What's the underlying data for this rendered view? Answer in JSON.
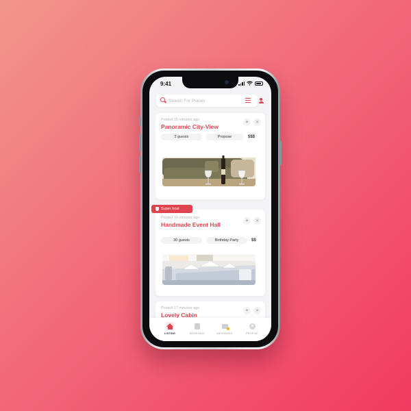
{
  "status_bar": {
    "time": "9:41"
  },
  "search": {
    "placeholder": "Search For Places"
  },
  "listings": [
    {
      "posted": "Posted 15 minutes ago",
      "title": "Panoramic City-View",
      "guests": "2 guests",
      "occasion": "Propose",
      "price": "$$$",
      "badge": ""
    },
    {
      "posted": "Posted 16 minutes ago",
      "title": "Handmade Event Hall",
      "guests": "30 guests",
      "occasion": "Birthday Party",
      "price": "$$",
      "badge": "Super host"
    },
    {
      "posted": "Posted 17 minutes ago",
      "title": "Lovely Cabin"
    }
  ],
  "tabs": [
    {
      "label": "LISTING",
      "icon": "home-icon",
      "active": true
    },
    {
      "label": "BOOKINGS",
      "icon": "bookings-icon",
      "active": false
    },
    {
      "label": "MESSAGES",
      "icon": "messages-icon",
      "active": false
    },
    {
      "label": "PROFILE",
      "icon": "profile-icon",
      "active": false
    }
  ],
  "colors": {
    "accent": "#e0434e",
    "background_start": "#f2968c",
    "background_end": "#f23a5f"
  }
}
